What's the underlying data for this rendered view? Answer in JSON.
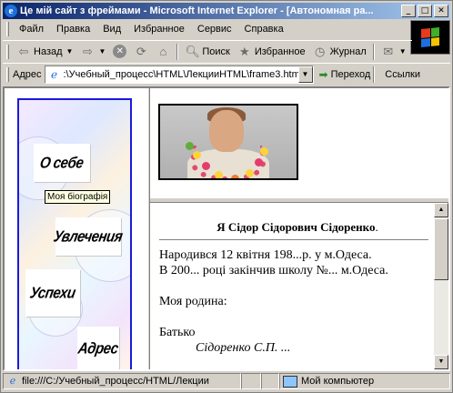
{
  "window": {
    "title": "Це мій сайт з фреймами - Microsoft Internet Explorer - [Автономная ра...",
    "controls": [
      "minimize",
      "maximize",
      "close"
    ]
  },
  "menubar": {
    "items": [
      "Файл",
      "Правка",
      "Вид",
      "Избранное",
      "Сервис",
      "Справка"
    ]
  },
  "toolbar": {
    "back_label": "Назад",
    "search_label": "Поиск",
    "favorites_label": "Избранное",
    "history_label": "Журнал"
  },
  "address": {
    "label": "Адрес",
    "value": ":\\Учебный_процесс\\HTML\\ЛекцииHTML\\frame3.html",
    "go_label": "Переход",
    "links_label": "Ссылки"
  },
  "nav": {
    "items": [
      "О себе",
      "Увлечения",
      "Успехи",
      "Адрес"
    ],
    "tooltip": "Моя біографія"
  },
  "bio": {
    "heading": "Я Сідор Сідорович Сідоренко",
    "heading_dot": ".",
    "line1": "Народився 12 квітня 198...р. у м.Одеса.",
    "line2": "В 200... році закінчив школу №... м.Одеса.",
    "line3": "Моя родина:",
    "line4": "Батько",
    "line5": "Сідоренко С.П. ..."
  },
  "statusbar": {
    "url": "file:///C:/Учебный_процесс/HTML/Лекции",
    "zone": "Мой компьютер"
  },
  "colors": {
    "title_start": "#0a246a",
    "title_end": "#a6caf0",
    "nav_border": "#1a1adc",
    "chrome": "#d4d0c8"
  },
  "icons": {
    "back": "back-arrow-icon",
    "forward": "forward-arrow-icon",
    "stop": "stop-icon",
    "refresh": "refresh-icon",
    "home": "home-icon",
    "search": "search-icon",
    "favorites": "favorites-icon",
    "history": "history-icon",
    "mail": "mail-icon",
    "go": "go-arrow-icon",
    "page": "ie-page-icon",
    "computer": "computer-icon"
  }
}
